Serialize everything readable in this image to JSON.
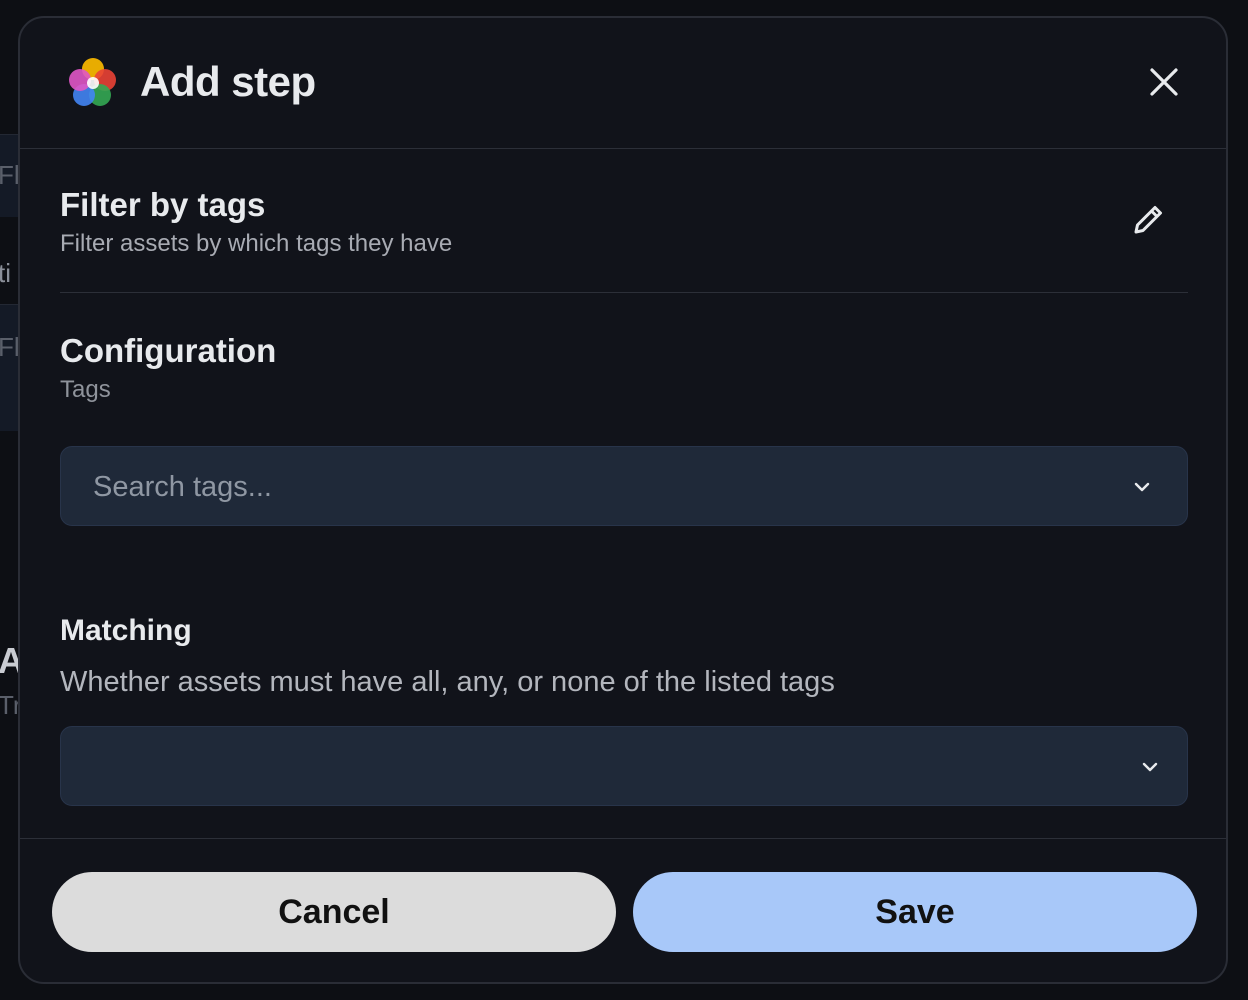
{
  "dialog": {
    "title": "Add step",
    "close_icon": "close-icon",
    "logo_icon": "pinwheel-logo-icon"
  },
  "step": {
    "name": "Filter by tags",
    "description": "Filter assets by which tags they have",
    "edit_icon": "pencil-icon"
  },
  "configuration": {
    "title": "Configuration",
    "field_label": "Tags",
    "search": {
      "placeholder": "Search tags...",
      "value": ""
    }
  },
  "matching": {
    "title": "Matching",
    "description": "Whether assets must have all, any, or none of the listed tags",
    "selected": ""
  },
  "footer": {
    "cancel_label": "Cancel",
    "save_label": "Save"
  },
  "colors": {
    "dialog_bg": "#11131a",
    "field_bg": "#1f2939",
    "save_bg": "#a8c8f9",
    "cancel_bg": "#dcdcdc"
  },
  "background_fragments": [
    "Fl",
    "ti",
    "Fl",
    "A",
    "Tr"
  ]
}
